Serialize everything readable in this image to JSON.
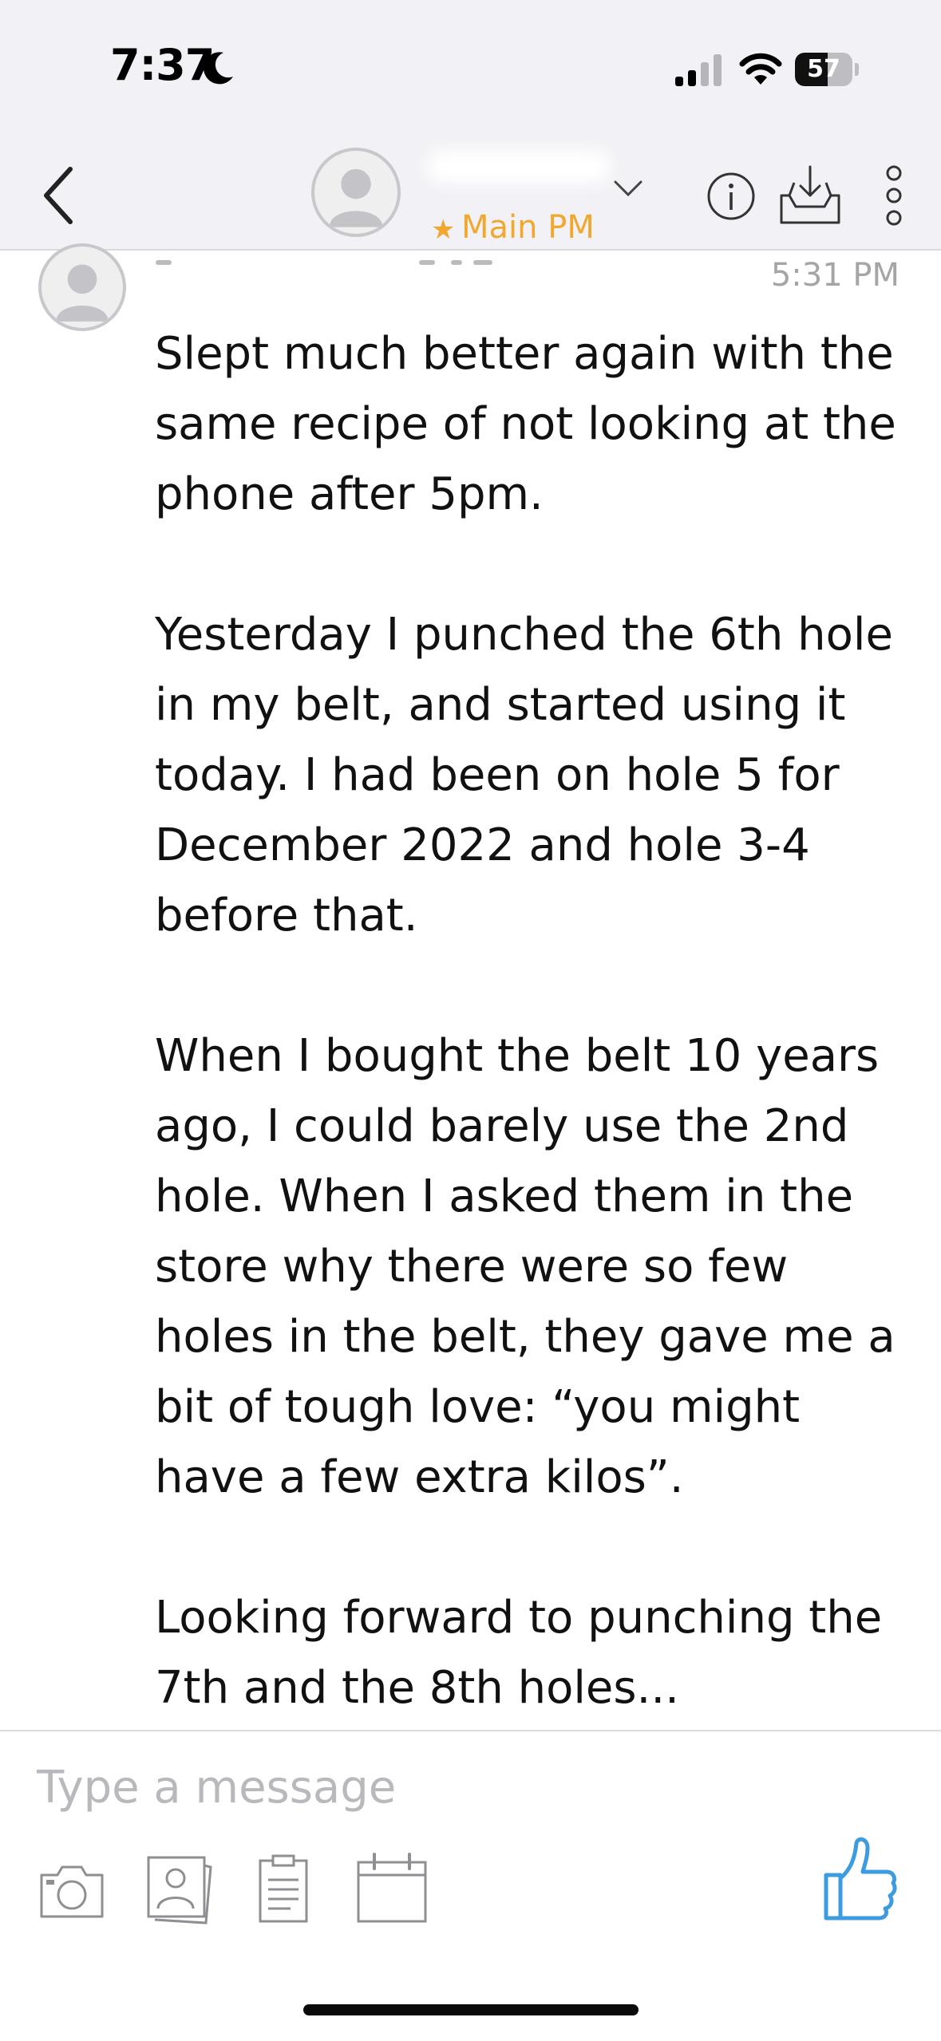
{
  "status_bar": {
    "time": "7:37",
    "battery": "57",
    "battery_level": 0.57
  },
  "header": {
    "contact_name": "",
    "channel_label": "Main PM"
  },
  "message": {
    "sender": "",
    "time": "5:31 PM",
    "paragraphs": [
      "Slept much better again with the same recipe of not looking at the phone after 5pm.",
      "Yesterday I punched the 6th hole in my belt, and started using it today. I had been on hole 5 for December 2022 and hole 3-4 before that.",
      "When I bought the belt 10 years ago, I could barely use the 2nd hole. When I asked them in the store why there were so few holes in the belt, they gave me a bit of tough love: “you might have a few extra kilos”.",
      "Looking forward to punching the 7th and the 8th holes..."
    ]
  },
  "composer": {
    "placeholder": "Type a message",
    "value": ""
  },
  "colors": {
    "accent_orange": "#f0a830",
    "like_blue": "#3d9be0",
    "icon_gray": "#8e8e93"
  },
  "icons": {
    "back": "chevron-left",
    "info": "info-circle",
    "inbox": "tray-arrow-down",
    "more": "vertical-ellipsis",
    "camera": "camera",
    "photo": "photo",
    "file": "clipboard",
    "calendar": "calendar",
    "like": "thumbs-up"
  }
}
